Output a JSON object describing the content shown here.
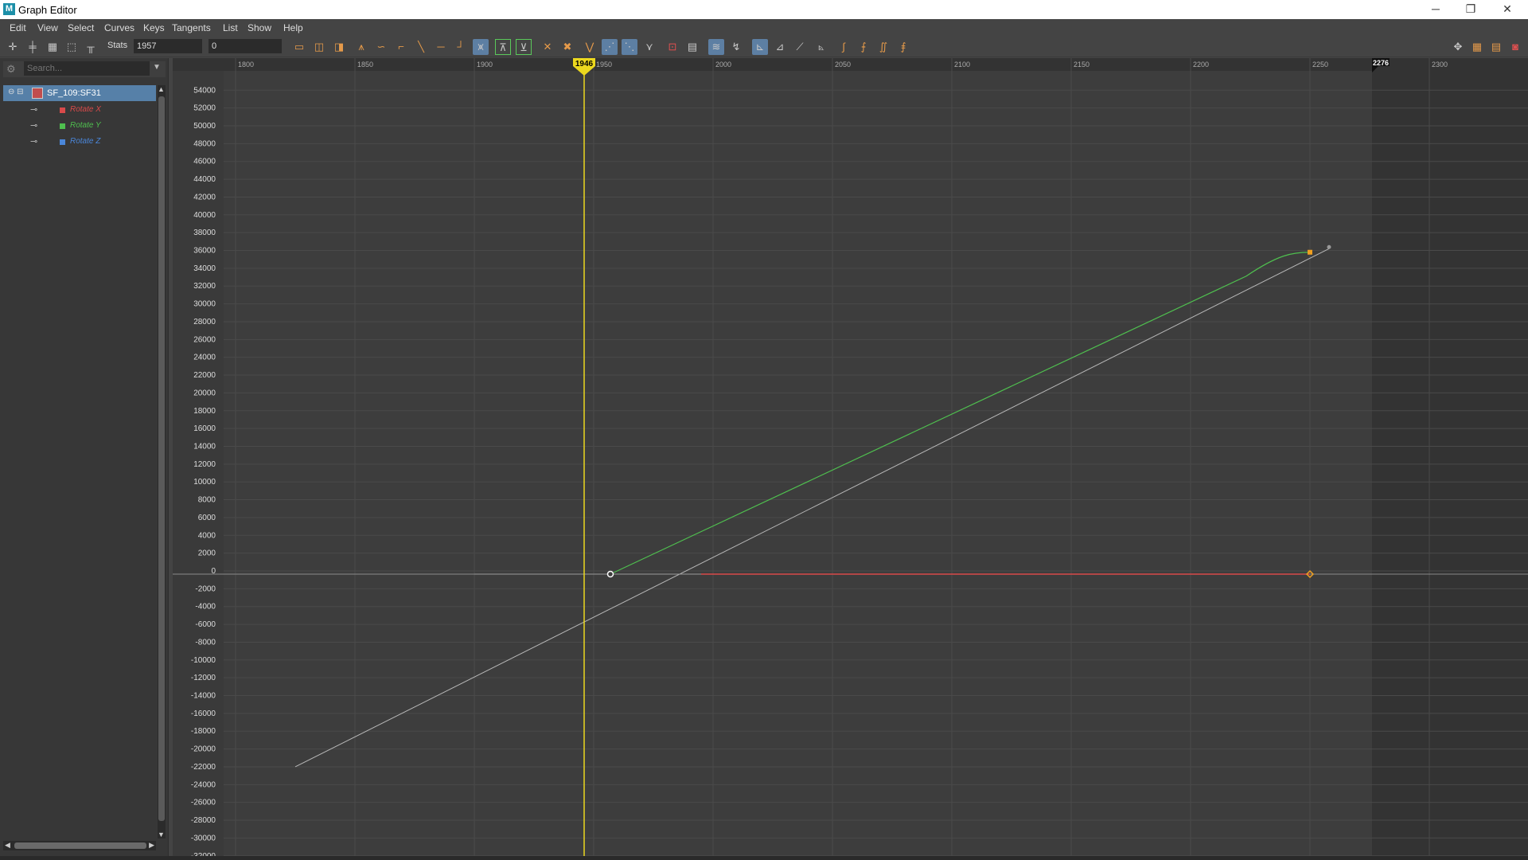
{
  "window": {
    "title": "Graph Editor",
    "app_icon": "M",
    "controls": {
      "minimize": "─",
      "restore": "❐",
      "close": "✕"
    }
  },
  "menu": [
    "Edit",
    "View",
    "Select",
    "Curves",
    "Keys",
    "Tangents",
    "List",
    "Show",
    "Help"
  ],
  "toolbar": {
    "stats_label": "Stats",
    "frame_value": "1957",
    "value_field": "0"
  },
  "outliner": {
    "search_placeholder": "Search...",
    "node": "SF_109:SF31",
    "channels": [
      {
        "name": "Rotate X",
        "color": "#d94a4a"
      },
      {
        "name": "Rotate Y",
        "color": "#4fbf4f"
      },
      {
        "name": "Rotate Z",
        "color": "#4a86d9"
      }
    ]
  },
  "graph": {
    "current_frame": "1946",
    "end_frame": "2276",
    "x_ticks": [
      "1800",
      "1850",
      "1900",
      "1950",
      "2000",
      "2050",
      "2100",
      "2150",
      "2200",
      "2250",
      "2300"
    ],
    "y_ticks": [
      "54000",
      "52000",
      "50000",
      "48000",
      "46000",
      "44000",
      "42000",
      "40000",
      "38000",
      "36000",
      "34000",
      "32000",
      "30000",
      "28000",
      "26000",
      "24000",
      "22000",
      "20000",
      "18000",
      "16000",
      "14000",
      "12000",
      "10000",
      "8000",
      "6000",
      "4000",
      "2000",
      "0",
      "-2000",
      "-4000",
      "-6000",
      "-8000",
      "-10000",
      "-12000",
      "-14000",
      "-16000",
      "-18000",
      "-20000",
      "-22000",
      "-24000",
      "-26000",
      "-28000",
      "-30000",
      "-32000"
    ],
    "colors": {
      "background": "#3d3d3d",
      "outside_range": "#333333",
      "grid": "#4a4a4a",
      "current_time": "#ecd81e",
      "curve_x": "#d94a4a",
      "curve_y": "#4fbf4f",
      "curve_z": "#4a86d9",
      "selected_key": "#f0a020",
      "tangent": "#b8b8b8"
    },
    "curves": {
      "rotate_x_keys": [
        [
          1995,
          0
        ],
        [
          2250,
          0
        ]
      ],
      "rotate_y_keys": [
        [
          1957,
          0
        ],
        [
          2250,
          35800
        ]
      ],
      "tangent_line": [
        [
          1825,
          -22000
        ],
        [
          2258,
          36200
        ]
      ]
    }
  }
}
